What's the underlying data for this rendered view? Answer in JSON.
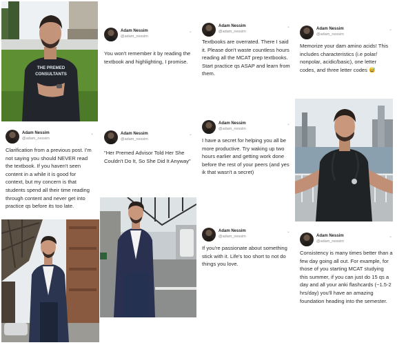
{
  "author": {
    "name": "Adam Nessim",
    "handle": "@adam_nessim"
  },
  "chevron_glyph": "⌄",
  "shirt_text": {
    "line1": "THE PREMED",
    "line2": "CONSULTANTS"
  },
  "tweets": [
    {
      "body": "You won't remember it by reading the textbook and highlighting, I promise."
    },
    {
      "body": "Textbooks are overrated. There I said it. Please don't waste countless hours reading all the MCAT prep textbooks. Start practice qs ASAP and learn from them."
    },
    {
      "body": "Memorize your dam amino acids! This includes characteristics (i.e polar/ nonpolar, acidic/basic), one letter codes, and three letter codes 😅"
    },
    {
      "body": "Clarification from a previous post. I'm not saying you should NEVER read the textbook. If you haven't seen content in a while it is good for context, but my concern is that students spend all their time reading through content and never get into practice qs before its too late."
    },
    {
      "body": "\"Her Premed Advisor Told Her She Couldn't Do It, So She Did It Anyway\""
    },
    {
      "body": "I have a secret for helping you all be more productive. Try waking up two hours earlier and getting work done before the rest of your peers (and yes ik that wasn't a secret)"
    },
    {
      "body": "If you're passionate about something stick with it. Life's too short to not do things you love."
    },
    {
      "body": "Consistency is many times better than a few day going all out. For example, for those of you starting MCAT studying this summer, if you can just do 15 qs a day and all your anki flashcards (~1.5-2 hrs/day) you'll have an amazing foundation heading into the semester."
    }
  ]
}
